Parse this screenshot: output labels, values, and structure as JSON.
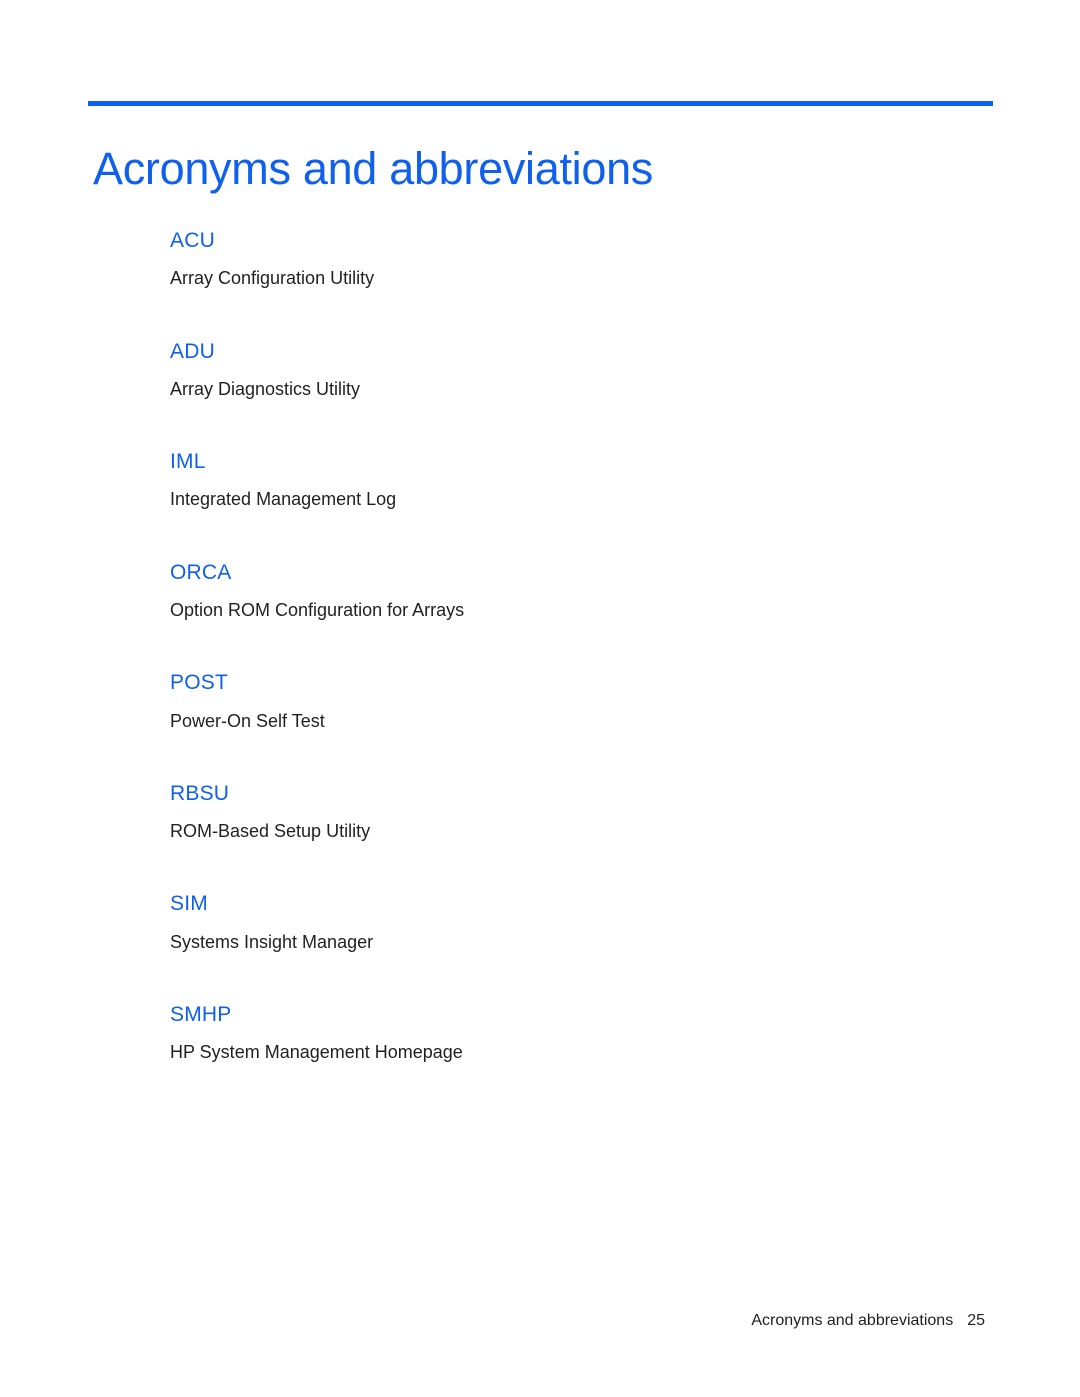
{
  "document": {
    "title": "Acronyms and abbreviations",
    "accent_color": "#1060ee",
    "rule_color": "#0a64ee",
    "text_color": "#231f20",
    "background_color": "#ffffff"
  },
  "glossary": {
    "entries": [
      {
        "term": "ACU",
        "definition": "Array Configuration Utility"
      },
      {
        "term": "ADU",
        "definition": "Array Diagnostics Utility"
      },
      {
        "term": "IML",
        "definition": "Integrated Management Log"
      },
      {
        "term": "ORCA",
        "definition": "Option ROM Configuration for Arrays"
      },
      {
        "term": "POST",
        "definition": "Power-On Self Test"
      },
      {
        "term": "RBSU",
        "definition": "ROM-Based Setup Utility"
      },
      {
        "term": "SIM",
        "definition": "Systems Insight Manager"
      },
      {
        "term": "SMHP",
        "definition": "HP System Management Homepage"
      }
    ]
  },
  "footer": {
    "chapter": "Acronyms and abbreviations",
    "page_number": "25"
  }
}
